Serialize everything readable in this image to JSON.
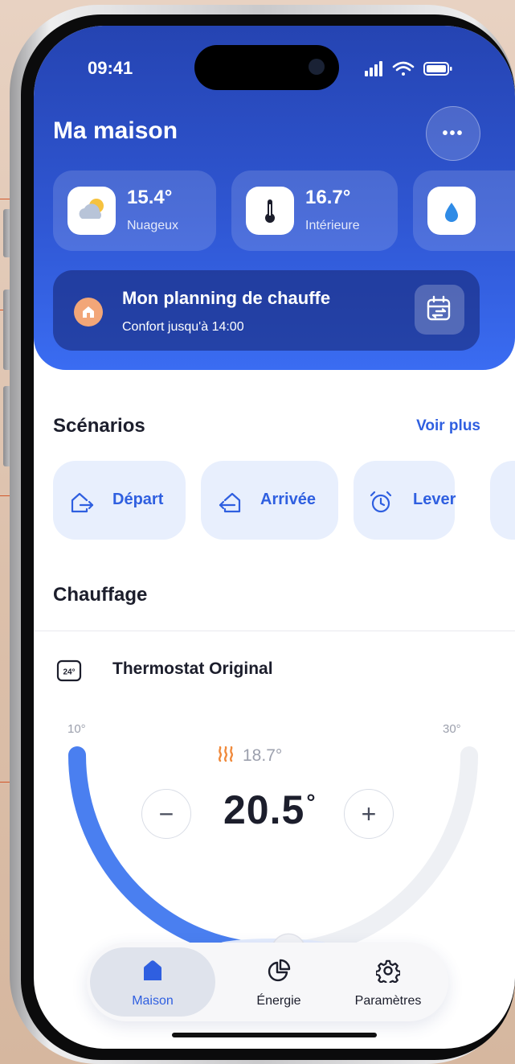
{
  "status_bar": {
    "time": "09:41"
  },
  "header": {
    "title": "Ma maison"
  },
  "weather_cards": [
    {
      "value": "15.4°",
      "label": "Nuageux",
      "icon": "cloud-sun-icon"
    },
    {
      "value": "16.7°",
      "label": "Intérieure",
      "icon": "thermometer-icon"
    },
    {
      "value": "",
      "label": "",
      "icon": "water-drop-icon"
    }
  ],
  "planning": {
    "title": "Mon planning de chauffe",
    "subtitle": "Confort jusqu'à 14:00"
  },
  "scenarios": {
    "title": "Scénarios",
    "see_more": "Voir plus",
    "items": [
      {
        "label": "Départ",
        "icon": "leave-home-icon"
      },
      {
        "label": "Arrivée",
        "icon": "arrive-home-icon"
      },
      {
        "label": "Lever",
        "icon": "alarm-clock-icon"
      }
    ]
  },
  "heating": {
    "title": "Chauffage",
    "thermostat_badge": "24°",
    "thermostat_name": "Thermostat Original",
    "min_label": "10°",
    "max_label": "30°",
    "current_temp": "18.7°",
    "setpoint": "20.5",
    "setpoint_unit": "°",
    "decrease": "−",
    "increase": "+",
    "range": [
      10,
      30
    ],
    "setpoint_value": 20.5
  },
  "tabbar": [
    {
      "label": "Maison",
      "icon": "home-icon",
      "active": true
    },
    {
      "label": "Énergie",
      "icon": "pie-chart-icon",
      "active": false
    },
    {
      "label": "Paramètres",
      "icon": "gear-icon",
      "active": false
    }
  ],
  "colors": {
    "accent": "#2f5fe0",
    "hero": "#2f56d2",
    "heat": "#f08a3c"
  }
}
